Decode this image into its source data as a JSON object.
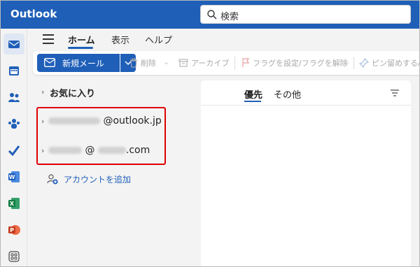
{
  "app": {
    "title": "Outlook"
  },
  "search": {
    "placeholder": "検索"
  },
  "tabs": [
    {
      "label": "ホーム",
      "active": true
    },
    {
      "label": "表示"
    },
    {
      "label": "ヘルプ"
    }
  ],
  "toolbar": {
    "new_mail": "新規メール",
    "delete": "削除",
    "archive": "アーカイブ",
    "flag": "フラグを設定/フラグを解除",
    "pin": "ピン留めする/ピ"
  },
  "folders": {
    "favorites": "お気に入り",
    "account1_suffix": "@outlook.jp",
    "account2_at": "@",
    "account2_suffix": ".com",
    "add_account": "アカウントを追加"
  },
  "message_list": {
    "focused": "優先",
    "other": "その他"
  },
  "rail": {
    "icons": [
      "mail-icon",
      "calendar-icon",
      "people-icon",
      "groups-icon",
      "todo-icon",
      "word-icon",
      "excel-icon",
      "powerpoint-icon",
      "apps-icon"
    ]
  },
  "colors": {
    "accent": "#1f5fb8",
    "highlight_box": "#e00000"
  }
}
